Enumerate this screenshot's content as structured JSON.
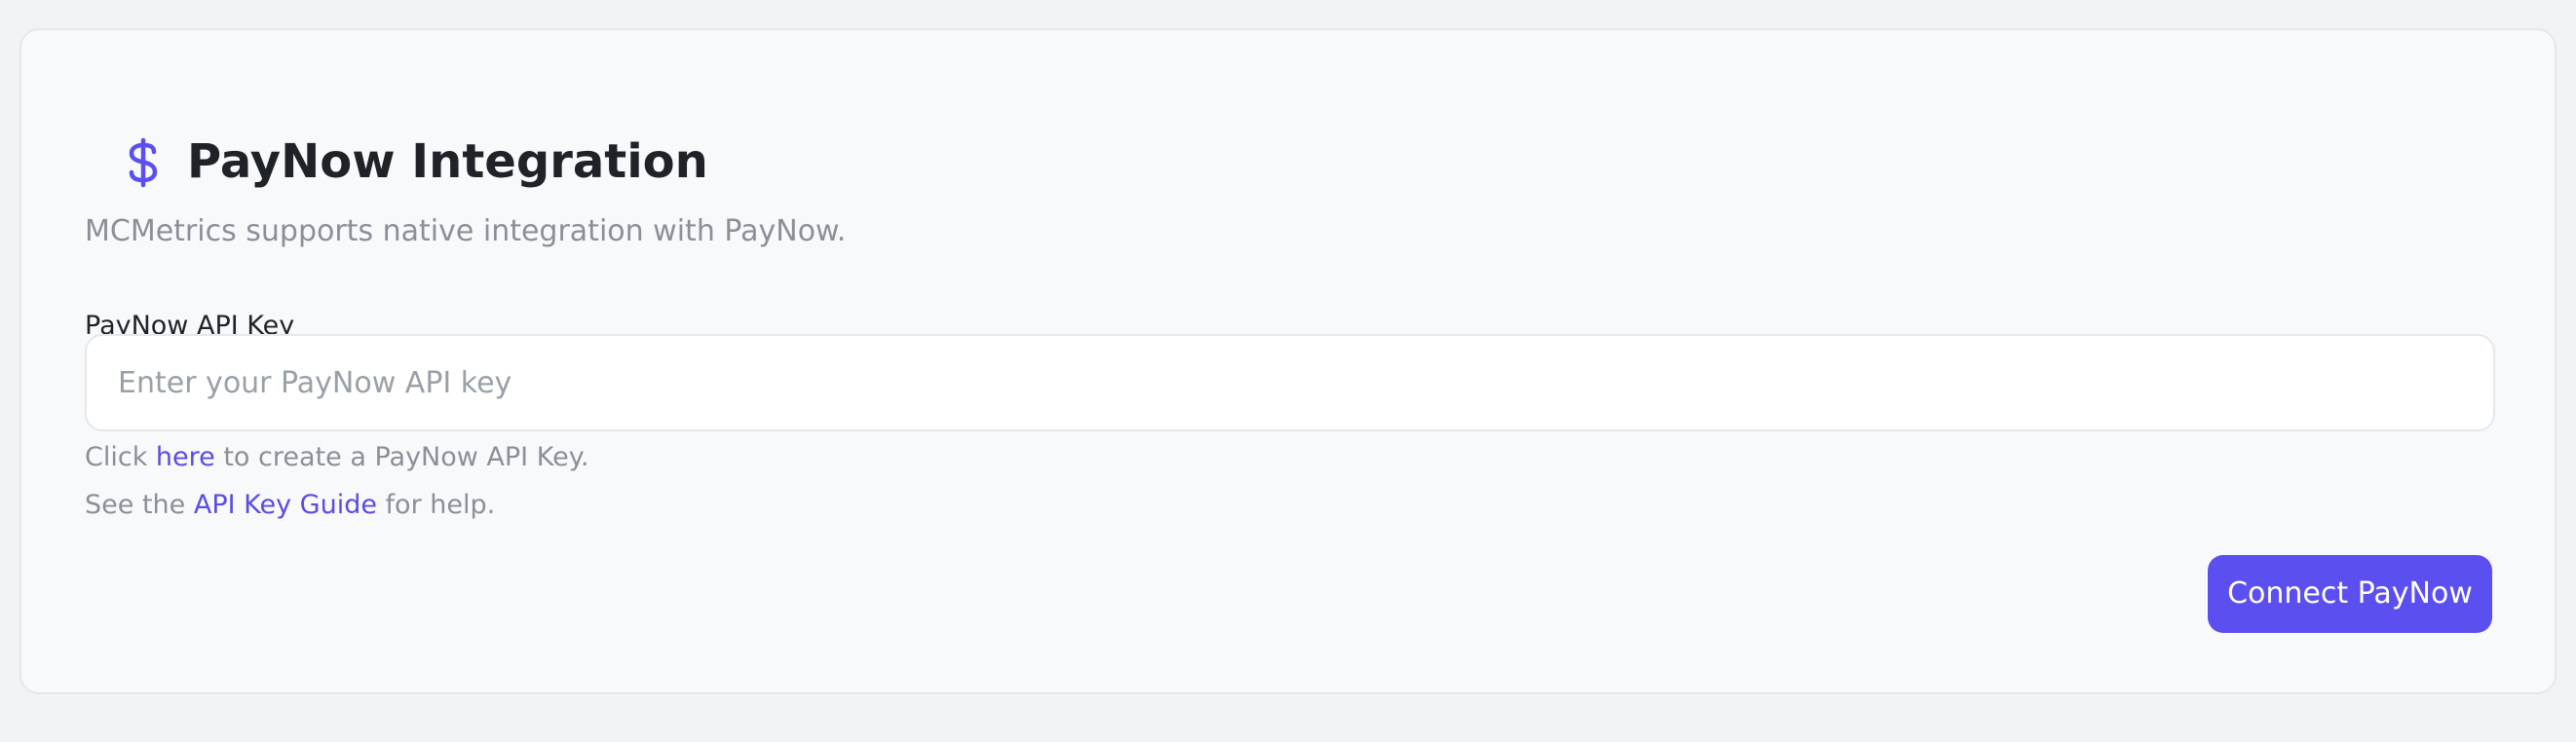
{
  "integration": {
    "icon": "dollar-icon",
    "title": "PayNow Integration",
    "description": "MCMetrics supports native integration with PayNow."
  },
  "form": {
    "field_label": "PayNow API Key",
    "api_key_value": "",
    "api_key_placeholder": "Enter your PayNow API key"
  },
  "help": {
    "line1_prefix": "Click ",
    "line1_link": "here",
    "line1_suffix": " to create a PayNow API Key.",
    "line2_prefix": "See the ",
    "line2_link": "API Key Guide",
    "line2_suffix": " for help."
  },
  "actions": {
    "connect_label": "Connect PayNow"
  },
  "colors": {
    "accent": "#5c4ff0",
    "link": "#5a4de3",
    "title": "#1f2328",
    "muted_text": "#8b8f97",
    "card_background": "#f8f9fa",
    "page_background": "#f2f3f5"
  }
}
